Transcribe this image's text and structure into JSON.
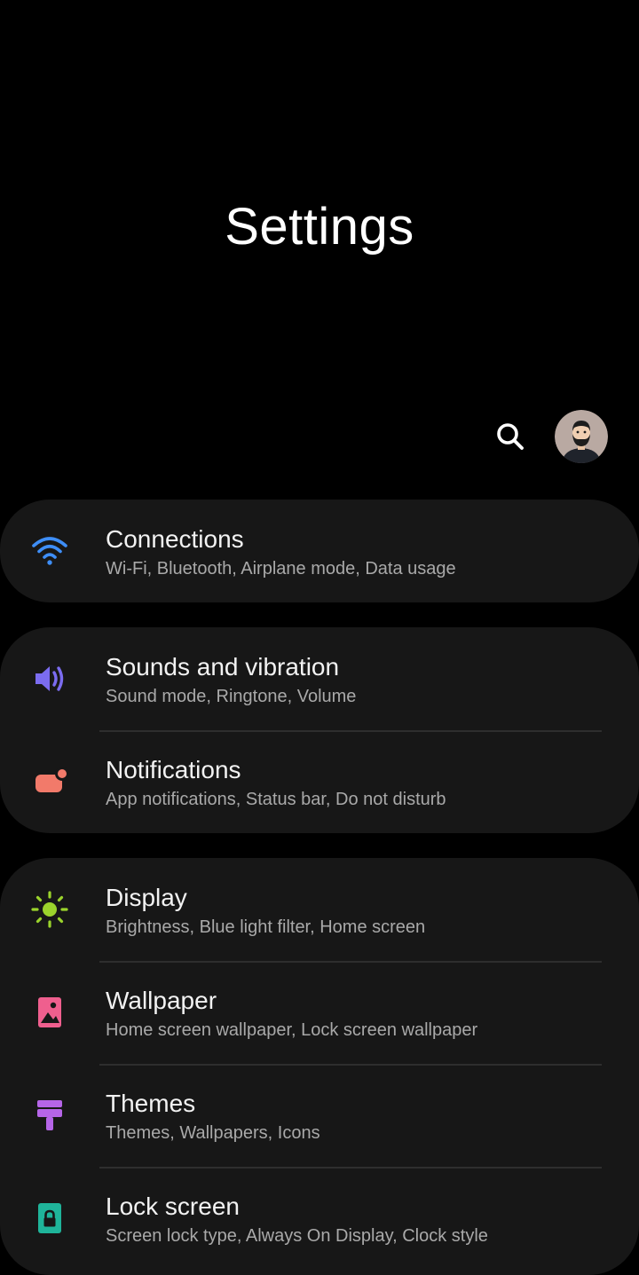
{
  "header": {
    "title": "Settings",
    "search_icon": "search-icon",
    "avatar_icon": "profile-avatar"
  },
  "cards": [
    {
      "items": [
        {
          "label": "Connections",
          "subtitle": "Wi-Fi, Bluetooth, Airplane mode, Data usage",
          "icon": "wifi-icon",
          "color": "#3e8ef7"
        }
      ]
    },
    {
      "items": [
        {
          "label": "Sounds and vibration",
          "subtitle": "Sound mode, Ringtone, Volume",
          "icon": "volume-icon",
          "color": "#7b6cf0"
        },
        {
          "label": "Notifications",
          "subtitle": "App notifications, Status bar, Do not disturb",
          "icon": "notification-icon",
          "color": "#f27a6a"
        }
      ]
    },
    {
      "items": [
        {
          "label": "Display",
          "subtitle": "Brightness, Blue light filter, Home screen",
          "icon": "sun-icon",
          "color": "#9bd42c"
        },
        {
          "label": "Wallpaper",
          "subtitle": "Home screen wallpaper, Lock screen wallpaper",
          "icon": "image-icon",
          "color": "#ef5f8e"
        },
        {
          "label": "Themes",
          "subtitle": "Themes, Wallpapers, Icons",
          "icon": "paint-roller-icon",
          "color": "#b665e8"
        },
        {
          "label": "Lock screen",
          "subtitle": "Screen lock type, Always On Display, Clock style",
          "icon": "lock-icon",
          "color": "#1fb49a"
        }
      ]
    }
  ]
}
